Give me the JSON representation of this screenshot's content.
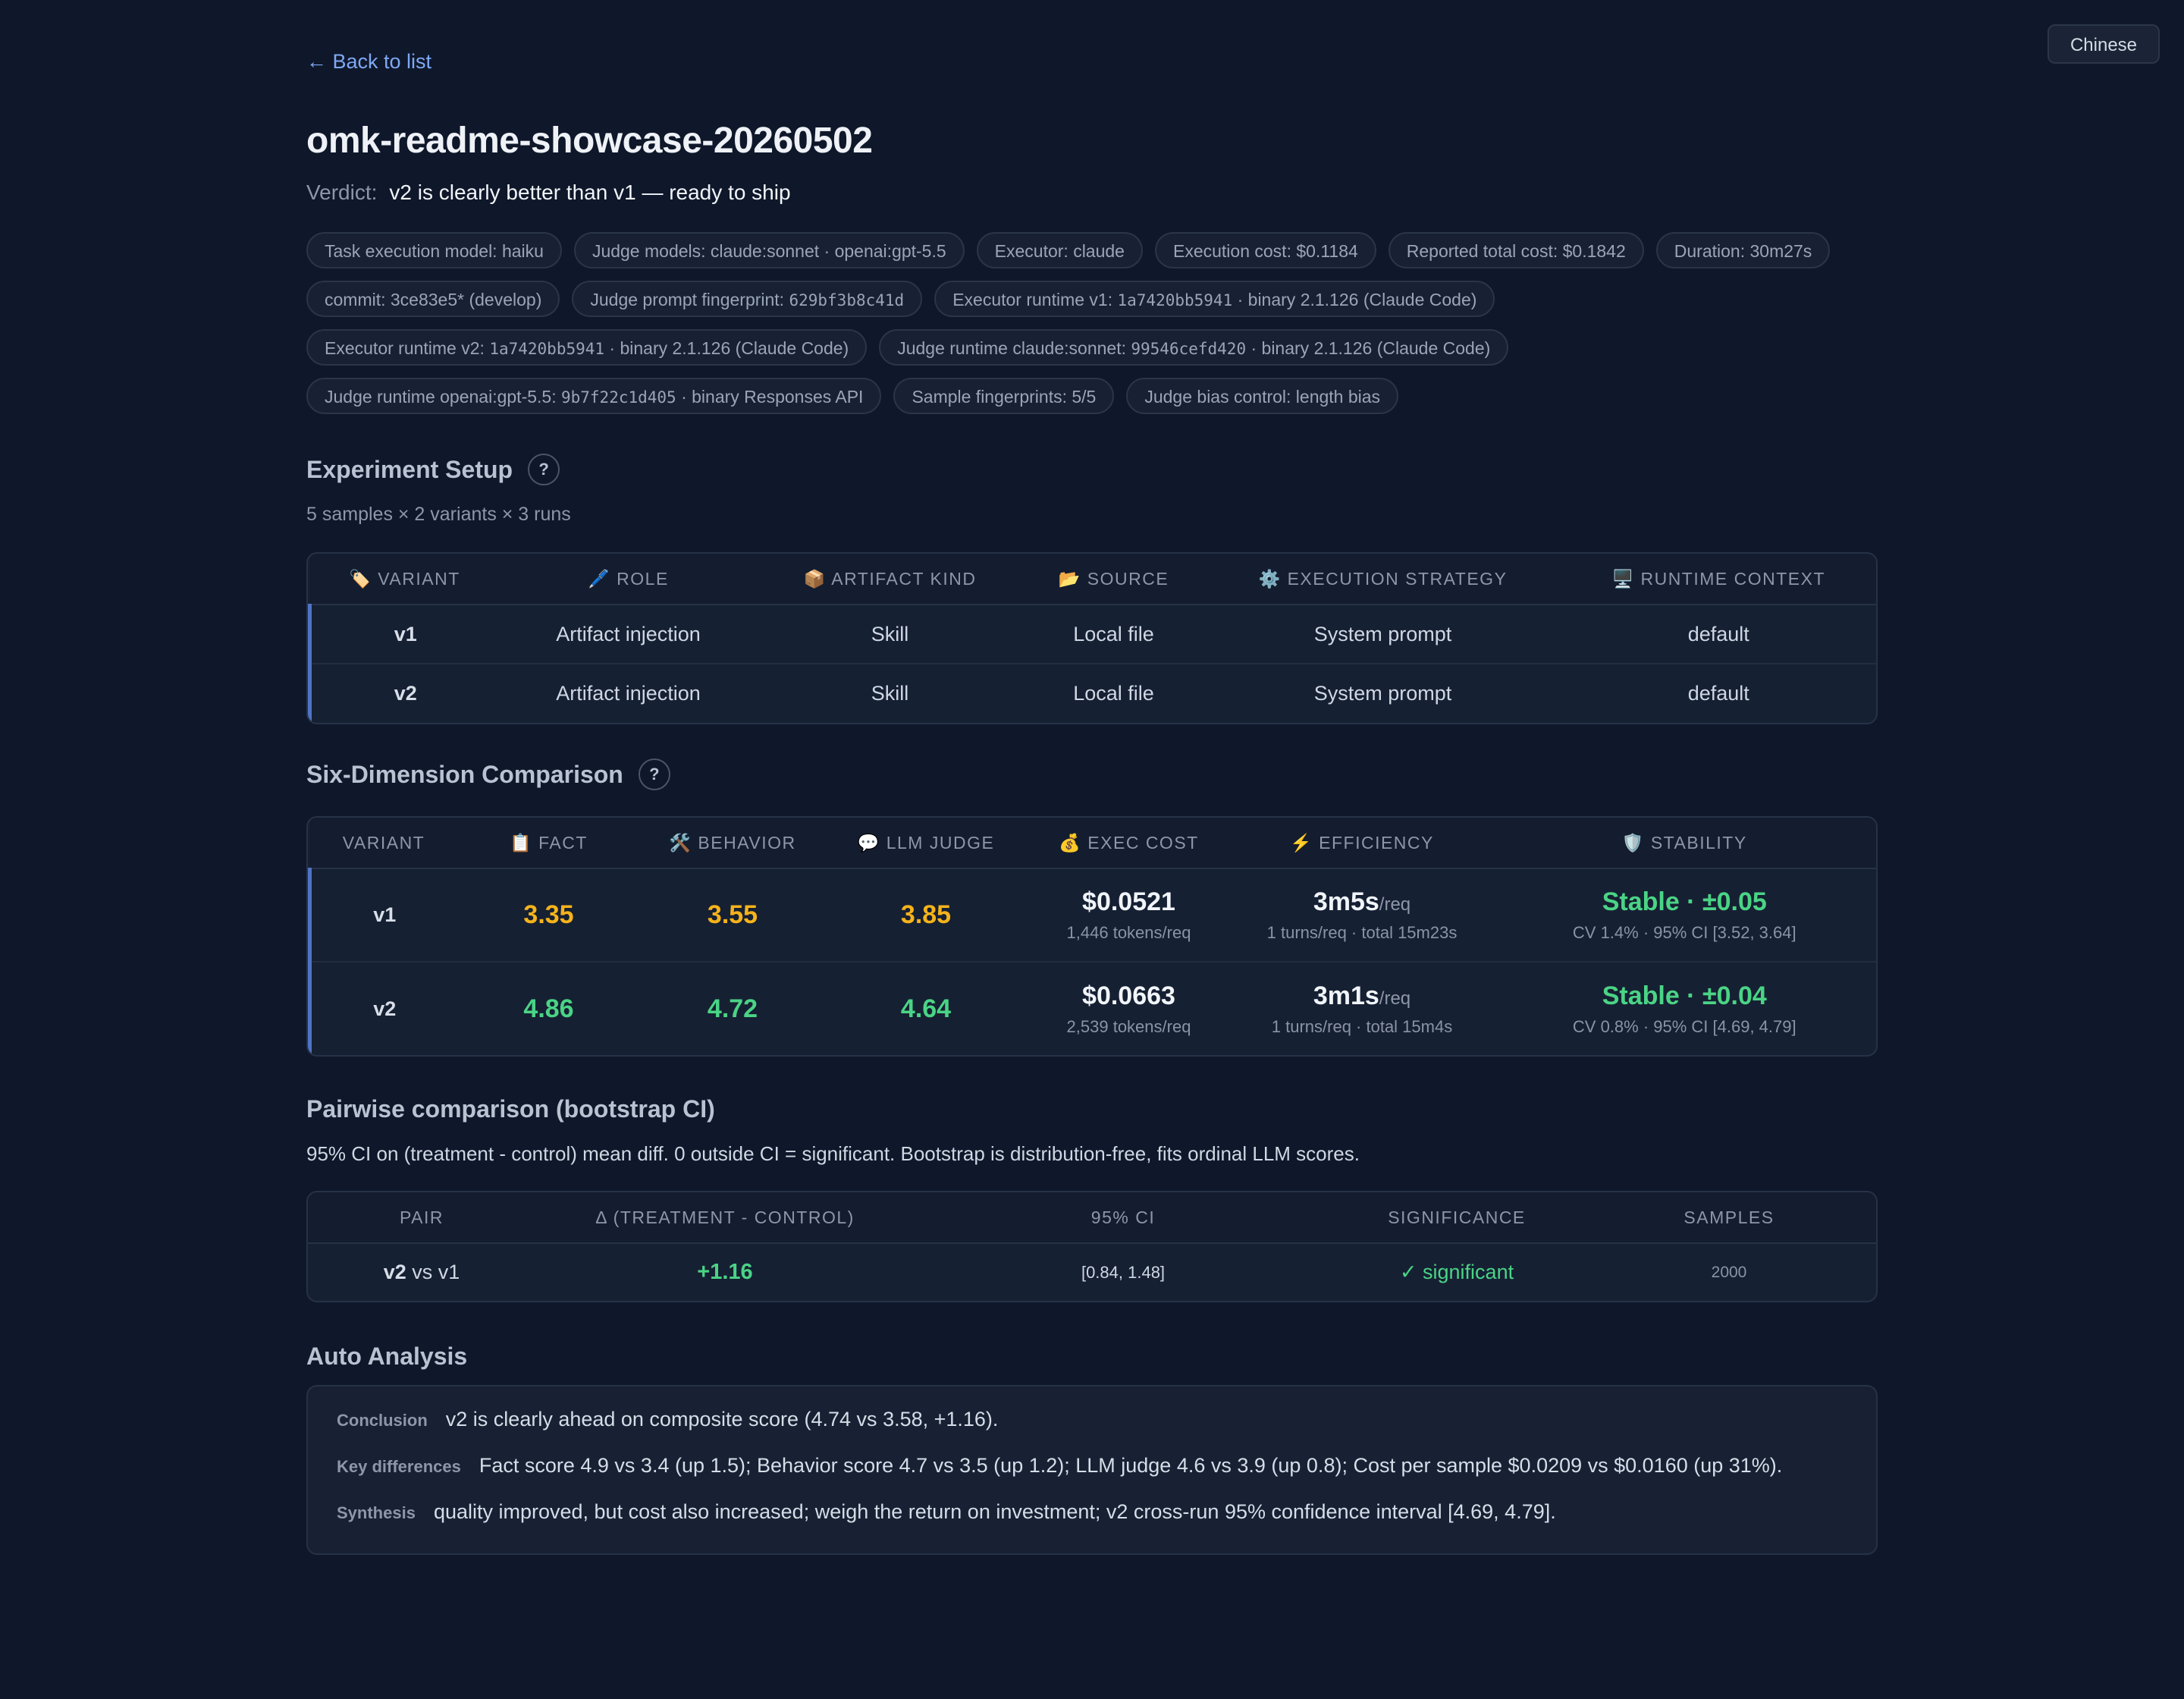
{
  "lang_button": "Chinese",
  "back_link": "← Back to list",
  "title": "omk-readme-showcase-20260502",
  "verdict": {
    "label": "Verdict:",
    "value": "v2 is clearly better than v1 — ready to ship"
  },
  "chips": [
    "Task execution model: haiku",
    "Judge models: claude:sonnet · openai:gpt-5.5",
    "Executor: claude",
    "Execution cost: $0.1184",
    "Reported total cost: $0.1842",
    "Duration: 30m27s",
    "commit: 3ce83e5* (develop)",
    "Judge prompt fingerprint: 629bf3b8c41d",
    "Executor runtime v1: 1a7420bb5941 · binary 2.1.126 (Claude Code)",
    "Executor runtime v2: 1a7420bb5941 · binary 2.1.126 (Claude Code)",
    "Judge runtime claude:sonnet: 99546cefd420 · binary 2.1.126 (Claude Code)",
    "Judge runtime openai:gpt-5.5: 9b7f22c1d405 · binary Responses API",
    "Sample fingerprints: 5/5",
    "Judge bias control: length bias"
  ],
  "setup": {
    "title": "Experiment Setup",
    "help": "?",
    "subtitle": "5 samples × 2 variants × 3 runs",
    "headers": [
      "🏷️ VARIANT",
      "🖊️ ROLE",
      "📦 ARTIFACT KIND",
      "📂 SOURCE",
      "⚙️ EXECUTION STRATEGY",
      "🖥️ RUNTIME CONTEXT"
    ],
    "rows": [
      [
        "v1",
        "Artifact injection",
        "Skill",
        "Local file",
        "System prompt",
        "default"
      ],
      [
        "v2",
        "Artifact injection",
        "Skill",
        "Local file",
        "System prompt",
        "default"
      ]
    ]
  },
  "six": {
    "title": "Six-Dimension Comparison",
    "help": "?",
    "headers": [
      "VARIANT",
      "📋 FACT",
      "🛠️ BEHAVIOR",
      "💬 LLM JUDGE",
      "💰 EXEC COST",
      "⚡ EFFICIENCY",
      "🛡️ STABILITY"
    ],
    "rows": [
      {
        "variant": "v1",
        "fact": "3.35",
        "behavior": "3.55",
        "judge": "3.85",
        "cost": "$0.0521",
        "cost_sub": "1,446 tokens/req",
        "eff": "3m5s",
        "eff_unit": "/req",
        "eff_sub": "1 turns/req · total 15m23s",
        "stab": "Stable · ±0.05",
        "stab_sub": "CV 1.4% · 95% CI [3.52, 3.64]"
      },
      {
        "variant": "v2",
        "fact": "4.86",
        "behavior": "4.72",
        "judge": "4.64",
        "cost": "$0.0663",
        "cost_sub": "2,539 tokens/req",
        "eff": "3m1s",
        "eff_unit": "/req",
        "eff_sub": "1 turns/req · total 15m4s",
        "stab": "Stable · ±0.04",
        "stab_sub": "CV 0.8% · 95% CI [4.69, 4.79]"
      }
    ]
  },
  "pairwise": {
    "title": "Pairwise comparison (bootstrap CI)",
    "subtitle": "95% CI on (treatment - control) mean diff. 0 outside CI = significant. Bootstrap is distribution-free, fits ordinal LLM scores.",
    "headers": [
      "PAIR",
      "Δ (TREATMENT - CONTROL)",
      "95% CI",
      "SIGNIFICANCE",
      "SAMPLES"
    ],
    "row": {
      "pair_a": "v2",
      "pair_vs": " vs v1",
      "delta": "+1.16",
      "ci": "[0.84, 1.48]",
      "sig": "✓ significant",
      "samples": "2000"
    }
  },
  "analysis": {
    "title": "Auto Analysis",
    "rows": [
      {
        "k": "Conclusion",
        "v": "v2 is clearly ahead on composite score (4.74 vs 3.58, +1.16)."
      },
      {
        "k": "Key differences",
        "v": "Fact score 4.9 vs 3.4 (up 1.5); Behavior score 4.7 vs 3.5 (up 1.2); LLM judge 4.6 vs 3.9 (up 0.8); Cost per sample $0.0209 vs $0.0160 (up 31%)."
      },
      {
        "k": "Synthesis",
        "v": "quality improved, but cost also increased; weigh the return on investment; v2 cross-run 95% confidence interval [4.69, 4.79]."
      }
    ]
  }
}
